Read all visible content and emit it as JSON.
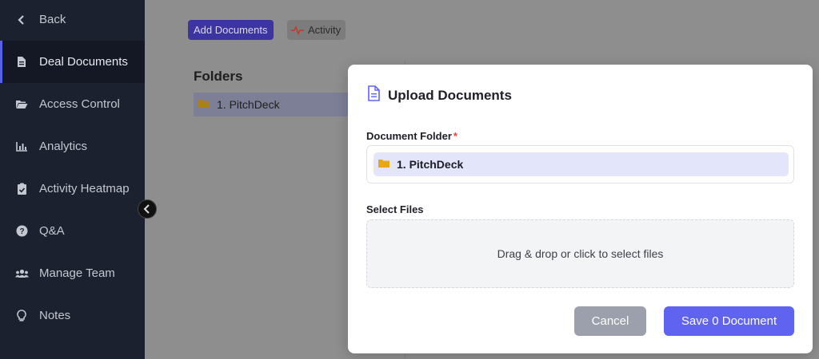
{
  "sidebar": {
    "items": [
      {
        "label": "Back",
        "icon": "chevron-left-icon"
      },
      {
        "label": "Deal Documents",
        "icon": "file-icon",
        "active": true
      },
      {
        "label": "Access Control",
        "icon": "folder-open-icon"
      },
      {
        "label": "Analytics",
        "icon": "bar-chart-icon"
      },
      {
        "label": "Activity Heatmap",
        "icon": "clipboard-check-icon"
      },
      {
        "label": "Q&A",
        "icon": "question-circle-icon"
      },
      {
        "label": "Manage Team",
        "icon": "users-icon"
      },
      {
        "label": "Notes",
        "icon": "lightbulb-icon"
      }
    ]
  },
  "toolbar": {
    "add_documents": "Add Documents",
    "activity": "Activity"
  },
  "folders": {
    "title": "Folders",
    "items": [
      {
        "label": "1. PitchDeck"
      }
    ]
  },
  "modal": {
    "title": "Upload Documents",
    "folder_label": "Document Folder",
    "required_mark": "*",
    "selected_folder": "1. PitchDeck",
    "files_label": "Select Files",
    "dropzone_text": "Drag & drop or click to select files",
    "cancel_label": "Cancel",
    "save_label": "Save 0 Document"
  },
  "colors": {
    "accent": "#5f63ef",
    "sidebar_bg": "#1c2130",
    "folder_icon": "#e6a817",
    "required": "#e0443d"
  }
}
